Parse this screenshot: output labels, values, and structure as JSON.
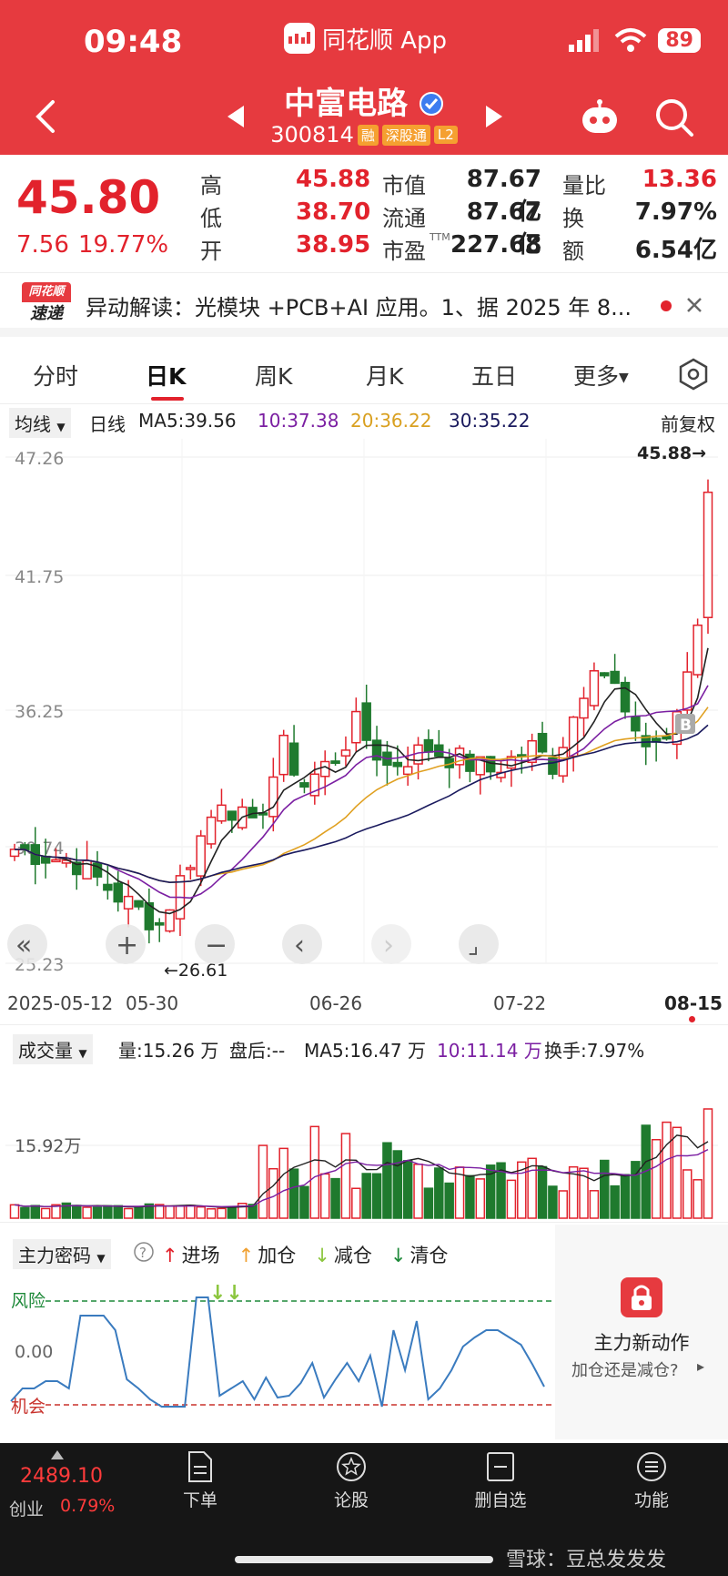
{
  "status": {
    "time": "09:48",
    "app_name": "同花顺 App",
    "battery": "89"
  },
  "stock": {
    "name": "中富电路",
    "code": "300814",
    "tags": [
      "融",
      "深股通",
      "L2"
    ],
    "price": "45.80",
    "change": "7.56",
    "change_pct": "19.77%",
    "stats": [
      {
        "label": "高",
        "value": "45.88",
        "color": "red"
      },
      {
        "label": "市值",
        "value": "87.67亿",
        "color": "dark"
      },
      {
        "label": "量比",
        "value": "13.36",
        "color": "red"
      },
      {
        "label": "低",
        "value": "38.70",
        "color": "red"
      },
      {
        "label": "流通",
        "value": "87.67亿",
        "color": "dark"
      },
      {
        "label": "换",
        "value": "7.97%",
        "color": "dark"
      },
      {
        "label": "开",
        "value": "38.95",
        "color": "red"
      },
      {
        "label": "市盈",
        "value": "227.68",
        "color": "dark"
      },
      {
        "label": "额",
        "value": "6.54亿",
        "color": "dark"
      }
    ],
    "pe_sup": "TTM"
  },
  "news": {
    "logo_top": "同花顺",
    "logo_bottom": "速递",
    "text": "异动解读：光模块 +PCB+AI 应用。1、据 2025 年 8..."
  },
  "tabs": [
    "分时",
    "日K",
    "周K",
    "月K",
    "五日",
    "更多"
  ],
  "active_tab": "日K",
  "ma_row": {
    "selector": "均线",
    "period": "日线",
    "ma5": "MA5:39.56",
    "ma10": "10:37.38",
    "ma20": "20:36.22",
    "ma30": "30:35.22",
    "adjust": "前复权"
  },
  "kline": {
    "y_labels": [
      "47.26",
      "41.75",
      "36.25",
      "30.74",
      "25.23"
    ],
    "high_marker": "45.88→",
    "low_marker": "←26.61",
    "dates": [
      "2025-05-12",
      "05-30",
      "06-26",
      "07-22",
      "08-15"
    ],
    "b_marker": "B",
    "nav_buttons": [
      "«",
      "+",
      "−",
      "‹",
      "›",
      "⌟"
    ]
  },
  "volume": {
    "selector": "成交量",
    "vol": "量:15.26 万",
    "after": "盘后:--",
    "ma5": "MA5:16.47 万",
    "ma10": "10:11.14 万",
    "turnover": "换手:7.97%",
    "y_label": "15.92万"
  },
  "main_force": {
    "selector": "主力密码",
    "legend": [
      {
        "label": "进场",
        "color": "#e2222c",
        "arrow": "↑"
      },
      {
        "label": "加仓",
        "color": "#f0a030",
        "arrow": "↑"
      },
      {
        "label": "减仓",
        "color": "#8cc63f",
        "arrow": "↓"
      },
      {
        "label": "清仓",
        "color": "#1f8a3a",
        "arrow": "↓"
      }
    ],
    "risk_label": "风险",
    "zero_label": "0.00",
    "chance_label": "机会",
    "promo_title": "主力新动作",
    "promo_sub": "加仓还是减仓?"
  },
  "bottom": {
    "index_value": "2489.10",
    "index_name": "创业",
    "index_pct": "0.79%",
    "items": [
      "下单",
      "论股",
      "删自选",
      "功能"
    ],
    "watermark": "雪球：豆总发发发"
  },
  "colors": {
    "header": "#e63a3f",
    "up": "#e2222c",
    "down": "#1f7a2e",
    "ma5": "#222222",
    "ma10": "#7b1fa2",
    "ma20": "#e0a020",
    "ma30": "#1a1a5e"
  }
}
